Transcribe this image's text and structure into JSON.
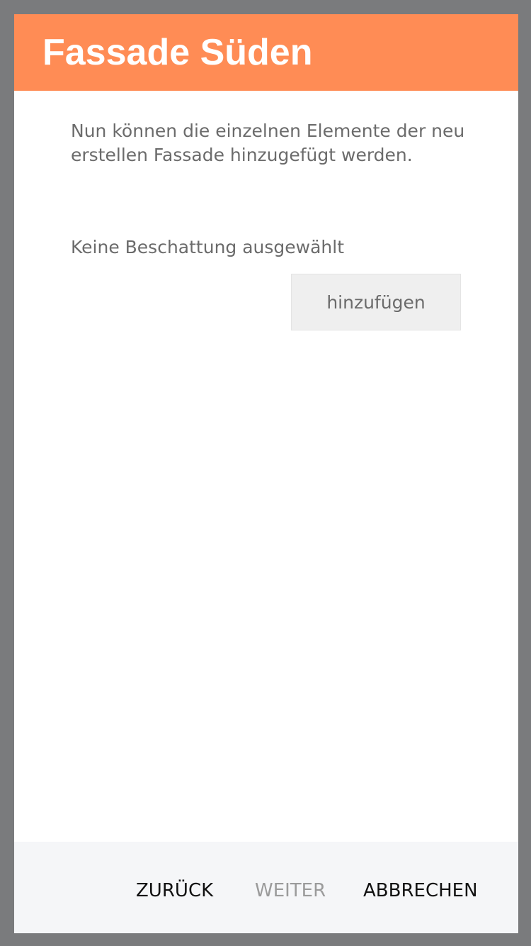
{
  "dialog": {
    "title": "Fassade Süden",
    "intro_text": "Nun können die einzelnen Elemente der neu erstellen Fassade hinzugefügt werden.",
    "shading_status": "Keine Beschattung ausgewählt",
    "add_button_label": "hinzufügen"
  },
  "footer": {
    "back_label": "ZURÜCK",
    "next_label": "WEITER",
    "cancel_label": "ABBRECHEN"
  },
  "colors": {
    "header_accent": "#ff8c55",
    "backdrop": "#7a7b7d",
    "disabled_text": "#9b9b9b"
  }
}
